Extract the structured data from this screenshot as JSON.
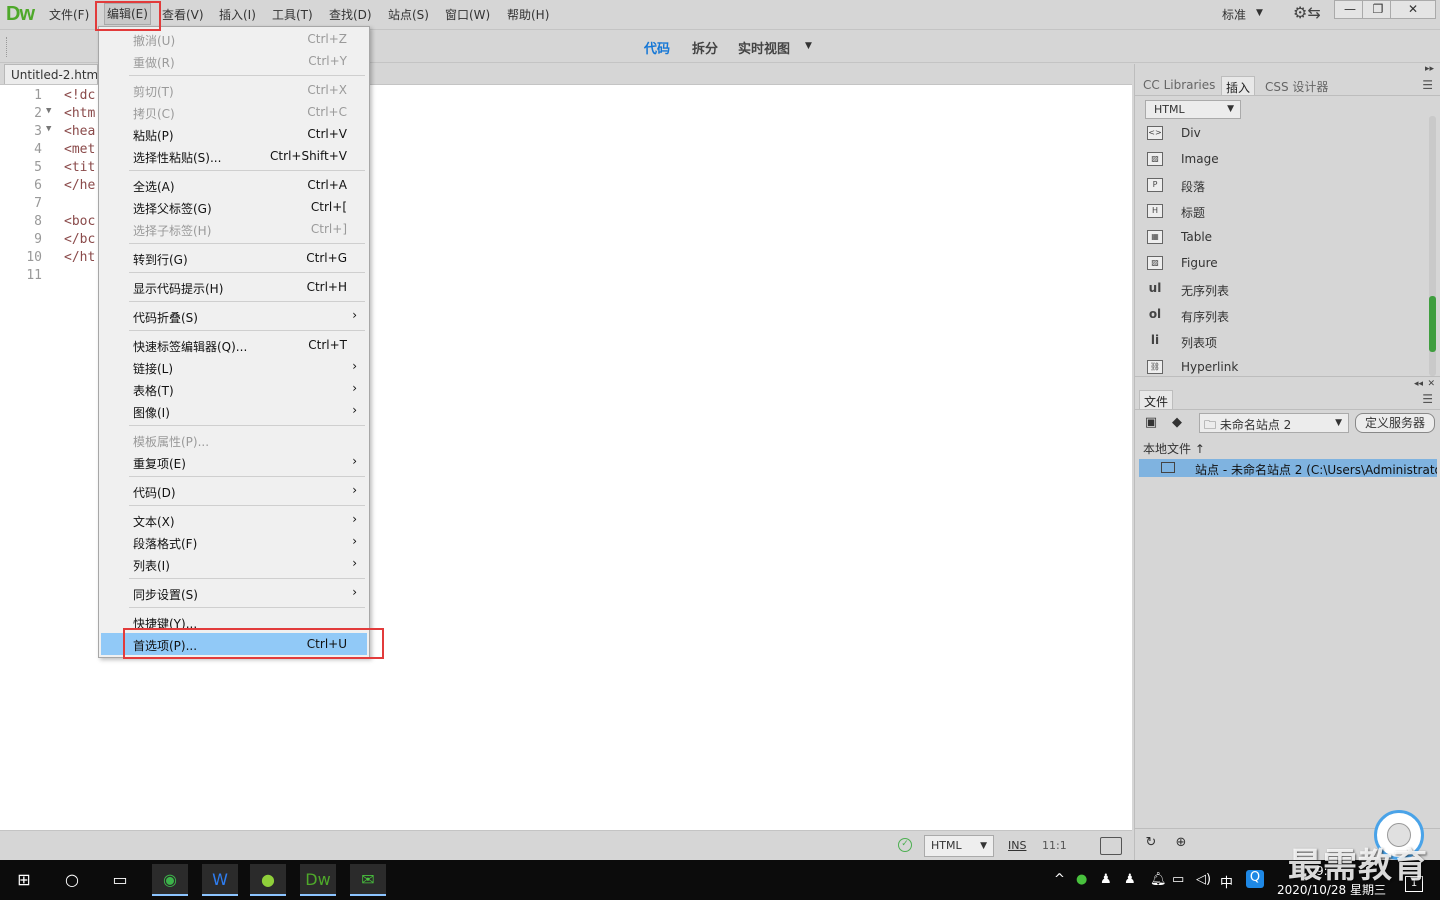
{
  "app": {
    "logo": "Dw"
  },
  "menubar": {
    "items": [
      "文件(F)",
      "编辑(E)",
      "查看(V)",
      "插入(I)",
      "工具(T)",
      "查找(D)",
      "站点(S)",
      "窗口(W)",
      "帮助(H)"
    ],
    "active_item": "编辑(E)",
    "workspace_label": "标准",
    "window_controls": [
      "—",
      "❐",
      "✕"
    ]
  },
  "toolbar": {
    "views": [
      "代码",
      "拆分",
      "实时视图"
    ],
    "active_view": "代码"
  },
  "document": {
    "tab_title": "Untitled-2.htm",
    "lines": [
      {
        "num": "1",
        "text": "<!dc",
        "fold": ""
      },
      {
        "num": "2",
        "text": "<htm",
        "fold": "▼"
      },
      {
        "num": "3",
        "text": "<hea",
        "fold": "▼"
      },
      {
        "num": "4",
        "text": "<met",
        "fold": ""
      },
      {
        "num": "5",
        "text": "<tit",
        "fold": ""
      },
      {
        "num": "6",
        "text": "</he",
        "fold": ""
      },
      {
        "num": "7",
        "text": "",
        "fold": ""
      },
      {
        "num": "8",
        "text": "<boc",
        "fold": ""
      },
      {
        "num": "9",
        "text": "</bc",
        "fold": ""
      },
      {
        "num": "10",
        "text": "</ht",
        "fold": ""
      },
      {
        "num": "11",
        "text": "",
        "fold": ""
      }
    ]
  },
  "edit_menu": {
    "groups": [
      [
        {
          "label": "撤消(U)",
          "shortcut": "Ctrl+Z",
          "disabled": true
        },
        {
          "label": "重做(R)",
          "shortcut": "Ctrl+Y",
          "disabled": true
        }
      ],
      [
        {
          "label": "剪切(T)",
          "shortcut": "Ctrl+X",
          "disabled": true
        },
        {
          "label": "拷贝(C)",
          "shortcut": "Ctrl+C",
          "disabled": true
        },
        {
          "label": "粘贴(P)",
          "shortcut": "Ctrl+V"
        },
        {
          "label": "选择性粘贴(S)...",
          "shortcut": "Ctrl+Shift+V"
        }
      ],
      [
        {
          "label": "全选(A)",
          "shortcut": "Ctrl+A"
        },
        {
          "label": "选择父标签(G)",
          "shortcut": "Ctrl+["
        },
        {
          "label": "选择子标签(H)",
          "shortcut": "Ctrl+]",
          "disabled": true
        }
      ],
      [
        {
          "label": "转到行(G)",
          "shortcut": "Ctrl+G"
        }
      ],
      [
        {
          "label": "显示代码提示(H)",
          "shortcut": "Ctrl+H"
        }
      ],
      [
        {
          "label": "代码折叠(S)",
          "submenu": true
        }
      ],
      [
        {
          "label": "快速标签编辑器(Q)...",
          "shortcut": "Ctrl+T"
        },
        {
          "label": "链接(L)",
          "submenu": true
        },
        {
          "label": "表格(T)",
          "submenu": true
        },
        {
          "label": "图像(I)",
          "submenu": true
        }
      ],
      [
        {
          "label": "模板属性(P)...",
          "disabled": true
        },
        {
          "label": "重复项(E)",
          "submenu": true
        }
      ],
      [
        {
          "label": "代码(D)",
          "submenu": true
        }
      ],
      [
        {
          "label": "文本(X)",
          "submenu": true
        },
        {
          "label": "段落格式(F)",
          "submenu": true
        },
        {
          "label": "列表(I)",
          "submenu": true
        }
      ],
      [
        {
          "label": "同步设置(S)",
          "submenu": true
        }
      ],
      [
        {
          "label": "快捷键(Y)..."
        },
        {
          "label": "首选项(P)...",
          "shortcut": "Ctrl+U",
          "highlight": true
        }
      ]
    ]
  },
  "insert_panel": {
    "tabs": [
      "CC Libraries",
      "插入",
      "CSS 设计器"
    ],
    "active_tab": "插入",
    "category": "HTML",
    "items": [
      {
        "icon": "div-icon",
        "glyph": "<>",
        "label": "Div"
      },
      {
        "icon": "image-icon",
        "glyph": "▨",
        "label": "Image"
      },
      {
        "icon": "paragraph-icon",
        "glyph": "P",
        "label": "段落"
      },
      {
        "icon": "heading-icon",
        "glyph": "H",
        "label": "标题"
      },
      {
        "icon": "table-icon",
        "glyph": "▦",
        "label": "Table"
      },
      {
        "icon": "figure-icon",
        "glyph": "▨",
        "label": "Figure"
      },
      {
        "icon": "ul-icon",
        "glyph": "ul",
        "label": "无序列表"
      },
      {
        "icon": "ol-icon",
        "glyph": "ol",
        "label": "有序列表"
      },
      {
        "icon": "li-icon",
        "glyph": "li",
        "label": "列表项"
      },
      {
        "icon": "hyperlink-icon",
        "glyph": "⛓",
        "label": "Hyperlink"
      }
    ]
  },
  "files_panel": {
    "tab": "文件",
    "site": "未命名站点 2",
    "define_server": "定义服务器",
    "local_files": "本地文件",
    "site_row": "站点 - 未命名站点 2 (C:\\Users\\Administrator\\..."
  },
  "statusbar": {
    "language": "HTML",
    "mode": "INS",
    "position": "11:1"
  },
  "taskbar": {
    "apps": [
      "start-icon",
      "search-icon",
      "task-view-icon",
      "browser-icon",
      "wps-icon",
      "app-icon",
      "dreamweaver-icon",
      "wechat-icon"
    ],
    "tray": {
      "ime": "中",
      "time": "9:",
      "date": "2020/10/28 星期三",
      "notifications": "1"
    }
  },
  "watermark": "最需教育"
}
